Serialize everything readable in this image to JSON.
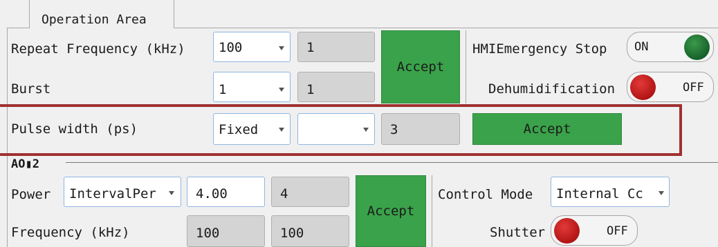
{
  "operation_area": {
    "tab_label": "Operation Area",
    "repeat_frequency": {
      "label": "Repeat Frequency (kHz)",
      "selected": "100",
      "readout": "1"
    },
    "burst": {
      "label": "Burst",
      "selected": "1",
      "readout": "1"
    },
    "accept_label": "Accept",
    "emergency_stop": {
      "label": "HMIEmergency Stop",
      "state": "ON"
    },
    "dehumidification": {
      "label": "Dehumidification",
      "state": "OFF"
    },
    "pulse_width": {
      "label": "Pulse width (ps)",
      "mode": "Fixed",
      "option": "",
      "readout": "3",
      "accept_label": "Accept"
    }
  },
  "aom2": {
    "title": "AO▮2",
    "power": {
      "label": "Power",
      "mode": "IntervalPer",
      "value": "4.00",
      "readout": "4"
    },
    "frequency": {
      "label": "Frequency (kHz)",
      "value": "100",
      "readout": "100"
    },
    "accept_label": "Accept",
    "control_mode": {
      "label": "Control Mode",
      "selected": "Internal Cc"
    },
    "shutter": {
      "label": "Shutter",
      "state": "OFF"
    }
  },
  "colors": {
    "accept_green": "#3aa24a",
    "input_border": "#8fb6e0",
    "highlight": "#a03030"
  }
}
